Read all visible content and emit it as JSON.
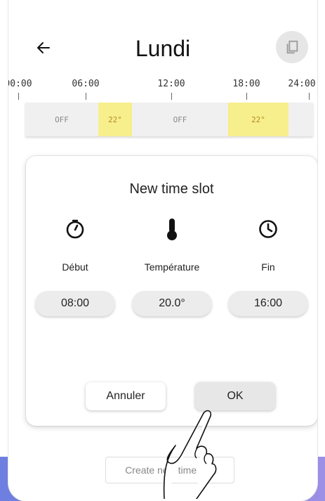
{
  "header": {
    "back_icon": "arrow-left-icon",
    "title": "Lundi",
    "copy_icon": "copy-icon"
  },
  "timeline": {
    "ticks": [
      "00:00",
      "06:00",
      "12:00",
      "18:00",
      "24:00"
    ],
    "segments": [
      {
        "label": "OFF",
        "state": "off"
      },
      {
        "label": "22°",
        "state": "heat"
      },
      {
        "label": "OFF",
        "state": "off"
      },
      {
        "label": "22°",
        "state": "heat"
      }
    ],
    "heat_color": "#f7ee8c"
  },
  "dialog": {
    "title": "New time slot",
    "columns": [
      {
        "icon": "stopwatch-icon",
        "label": "Début",
        "value": "08:00"
      },
      {
        "icon": "thermometer-icon",
        "label": "Température",
        "value": "20.0°"
      },
      {
        "icon": "clock-icon",
        "label": "Fin",
        "value": "16:00"
      }
    ],
    "cancel_label": "Annuler",
    "ok_label": "OK"
  },
  "footer": {
    "create_label": "Create new time slot"
  }
}
